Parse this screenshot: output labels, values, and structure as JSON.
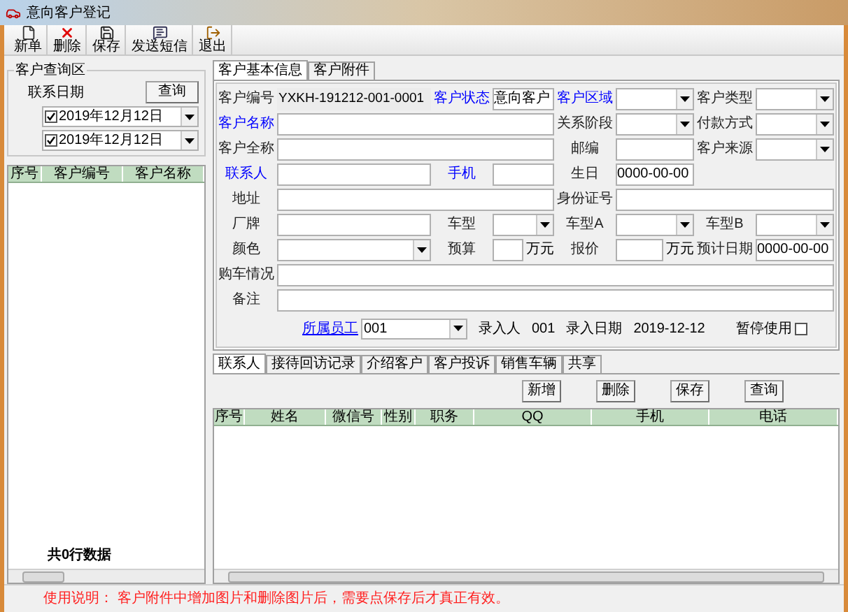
{
  "window": {
    "title": "意向客户登记"
  },
  "toolbar": [
    {
      "label": "新单",
      "kind": "new"
    },
    {
      "label": "删除",
      "kind": "delete"
    },
    {
      "label": "保存",
      "kind": "save"
    },
    {
      "label": "发送短信",
      "kind": "sms"
    },
    {
      "label": "退出",
      "kind": "exit"
    }
  ],
  "query_panel": {
    "title": "客户查询区",
    "date_label": "联系日期",
    "dates": [
      {
        "value": "2019年12月12日",
        "checked": true
      },
      {
        "value": "2019年12月12日",
        "checked": true
      }
    ],
    "button": "查询"
  },
  "customer_list": {
    "columns": [
      "序号",
      "客户编号",
      "客户名称"
    ],
    "footer": "共0行数据"
  },
  "detail_tabs": [
    {
      "label": "客户基本信息",
      "selected": true
    },
    {
      "label": "客户附件",
      "selected": false
    }
  ],
  "form": {
    "rows": [
      [
        {
          "label": "客户编号",
          "emphasis": false,
          "kind": "readonly",
          "value": "YXKH-191212-001-0001"
        },
        {
          "label": "客户状态",
          "emphasis": true,
          "kind": "text",
          "value": "意向客户"
        },
        {
          "label": "客户区域",
          "emphasis": true,
          "kind": "select"
        },
        {
          "label": "客户类型",
          "emphasis": false,
          "kind": "select"
        }
      ],
      [
        {
          "label": "客户名称",
          "emphasis": true,
          "kind": "wide_text"
        },
        {
          "label": "关系阶段",
          "emphasis": false,
          "kind": "select"
        },
        {
          "label": "付款方式",
          "emphasis": false,
          "kind": "select"
        }
      ],
      [
        {
          "label": "客户全称",
          "emphasis": false,
          "kind": "wide_text"
        },
        {
          "label": "邮编",
          "emphasis": false,
          "kind": "text"
        },
        {
          "label": "客户来源",
          "emphasis": false,
          "kind": "select"
        }
      ],
      [
        {
          "label": "联系人",
          "emphasis": true,
          "kind": "text"
        },
        {
          "label": "手机",
          "emphasis": true,
          "kind": "text"
        },
        {
          "label": "生日",
          "emphasis": false,
          "kind": "text",
          "value": "0000-00-00"
        }
      ],
      [
        {
          "label": "地址",
          "emphasis": false,
          "kind": "wide_text"
        },
        {
          "label": "身份证号",
          "emphasis": false,
          "kind": "wide_text"
        }
      ],
      [
        {
          "label": "厂牌",
          "emphasis": false,
          "kind": "text"
        },
        {
          "label": "车型",
          "emphasis": false,
          "kind": "select"
        },
        {
          "label": "车型A",
          "emphasis": false,
          "kind": "select"
        },
        {
          "label": "车型B",
          "emphasis": false,
          "kind": "select"
        }
      ],
      [
        {
          "label": "颜色",
          "emphasis": false,
          "kind": "select"
        },
        {
          "label": "预算",
          "emphasis": false,
          "kind": "text",
          "unit": "万元"
        },
        {
          "label": "报价",
          "emphasis": false,
          "kind": "text",
          "unit": "万元"
        },
        {
          "label": "预计日期",
          "emphasis": false,
          "kind": "text",
          "value": "0000-00-00"
        }
      ],
      [
        {
          "label": "购车情况",
          "emphasis": false,
          "kind": "full_text"
        }
      ],
      [
        {
          "label": "备注",
          "emphasis": false,
          "kind": "full_text"
        }
      ]
    ]
  },
  "form_footer": {
    "staff_label": "所属员工",
    "staff_value": "001",
    "entered_by_label": "录入人",
    "entered_by": "001",
    "entry_date_label": "录入日期",
    "entry_date": "2019-12-12",
    "suspend_label": "暂停使用",
    "suspended": false
  },
  "sub_tabs": [
    {
      "label": "联系人",
      "selected": true
    },
    {
      "label": "接待回访记录",
      "selected": false
    },
    {
      "label": "介绍客户",
      "selected": false
    },
    {
      "label": "客户投诉",
      "selected": false
    },
    {
      "label": "销售车辆",
      "selected": false
    },
    {
      "label": "共享",
      "selected": false
    }
  ],
  "sub_buttons": [
    "新增",
    "删除",
    "保存",
    "查询"
  ],
  "contacts_table": {
    "columns": [
      "序号",
      "姓名",
      "微信号",
      "性别",
      "职务",
      "QQ",
      "手机",
      "电话"
    ]
  },
  "status_bar": "使用说明： 客户附件中增加图片和删除图片后，需要点保存后才真正有效。"
}
